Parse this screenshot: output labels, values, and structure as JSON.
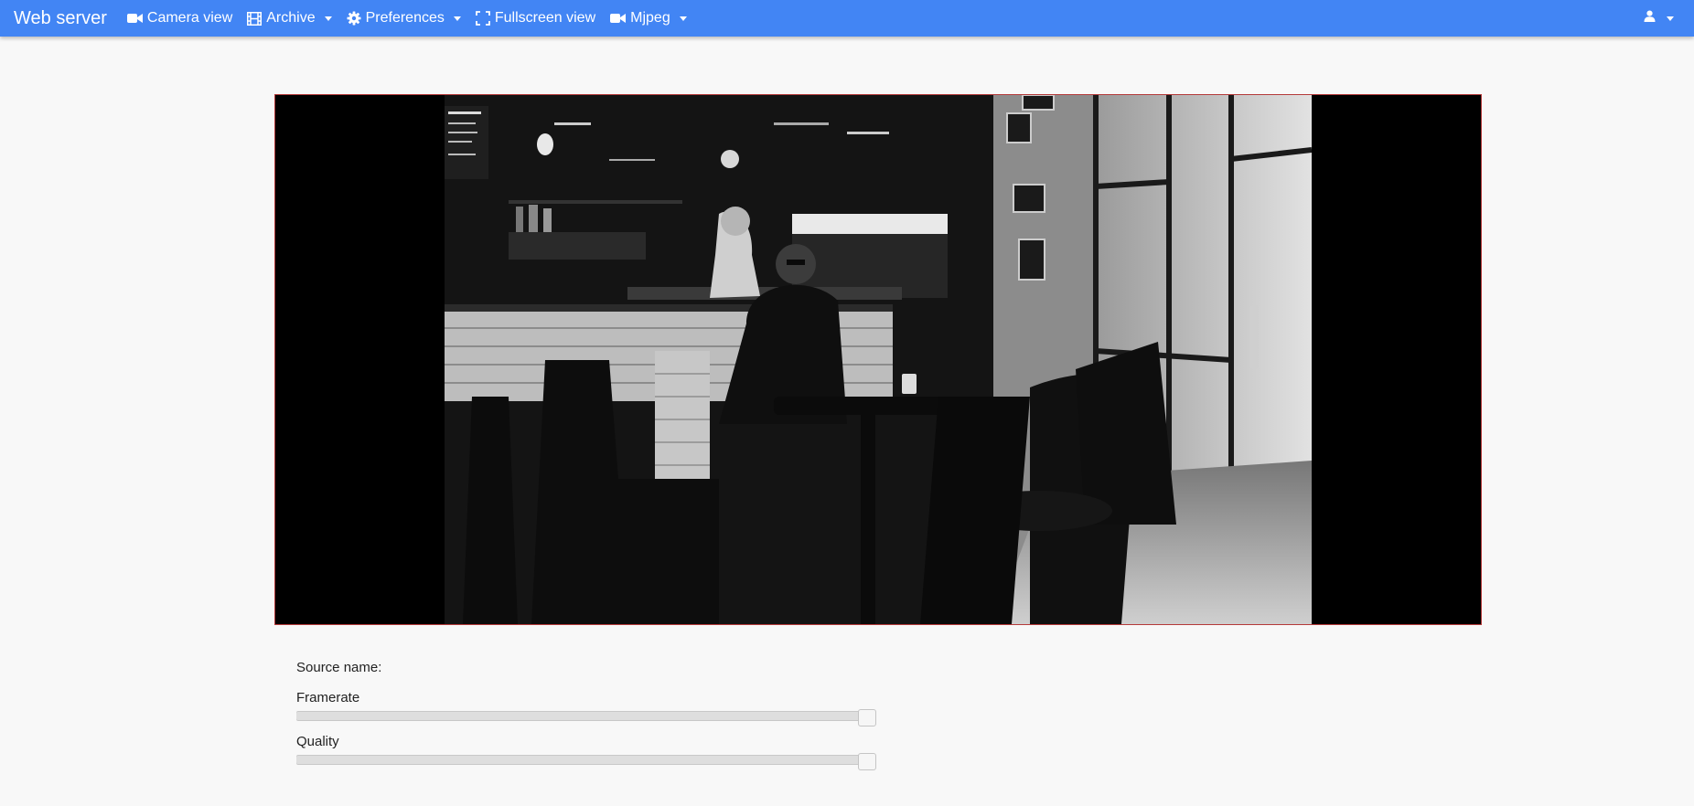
{
  "navbar": {
    "brand": "Web server",
    "items": [
      {
        "label": "Camera view",
        "icon": "video-camera-icon",
        "dropdown": false
      },
      {
        "label": "Archive",
        "icon": "film-icon",
        "dropdown": true
      },
      {
        "label": "Preferences",
        "icon": "gear-icon",
        "dropdown": true
      },
      {
        "label": "Fullscreen view",
        "icon": "fullscreen-icon",
        "dropdown": false
      },
      {
        "label": "Mjpeg",
        "icon": "video-camera-icon",
        "dropdown": true
      }
    ],
    "user_icon": "user-icon"
  },
  "video": {
    "content": "black-and-white photo of a café interior: counter with menu boards, a person behind the counter, a seated man in sunglasses, chairs and tables, bright windows"
  },
  "controls": {
    "source_label": "Source name:",
    "framerate_label": "Framerate",
    "framerate_value": 1.0,
    "quality_label": "Quality",
    "quality_value": 1.0
  },
  "colors": {
    "navbar": "#4285f4",
    "page_background": "#f8f8f8",
    "viewport_border": "#b43a3a"
  }
}
